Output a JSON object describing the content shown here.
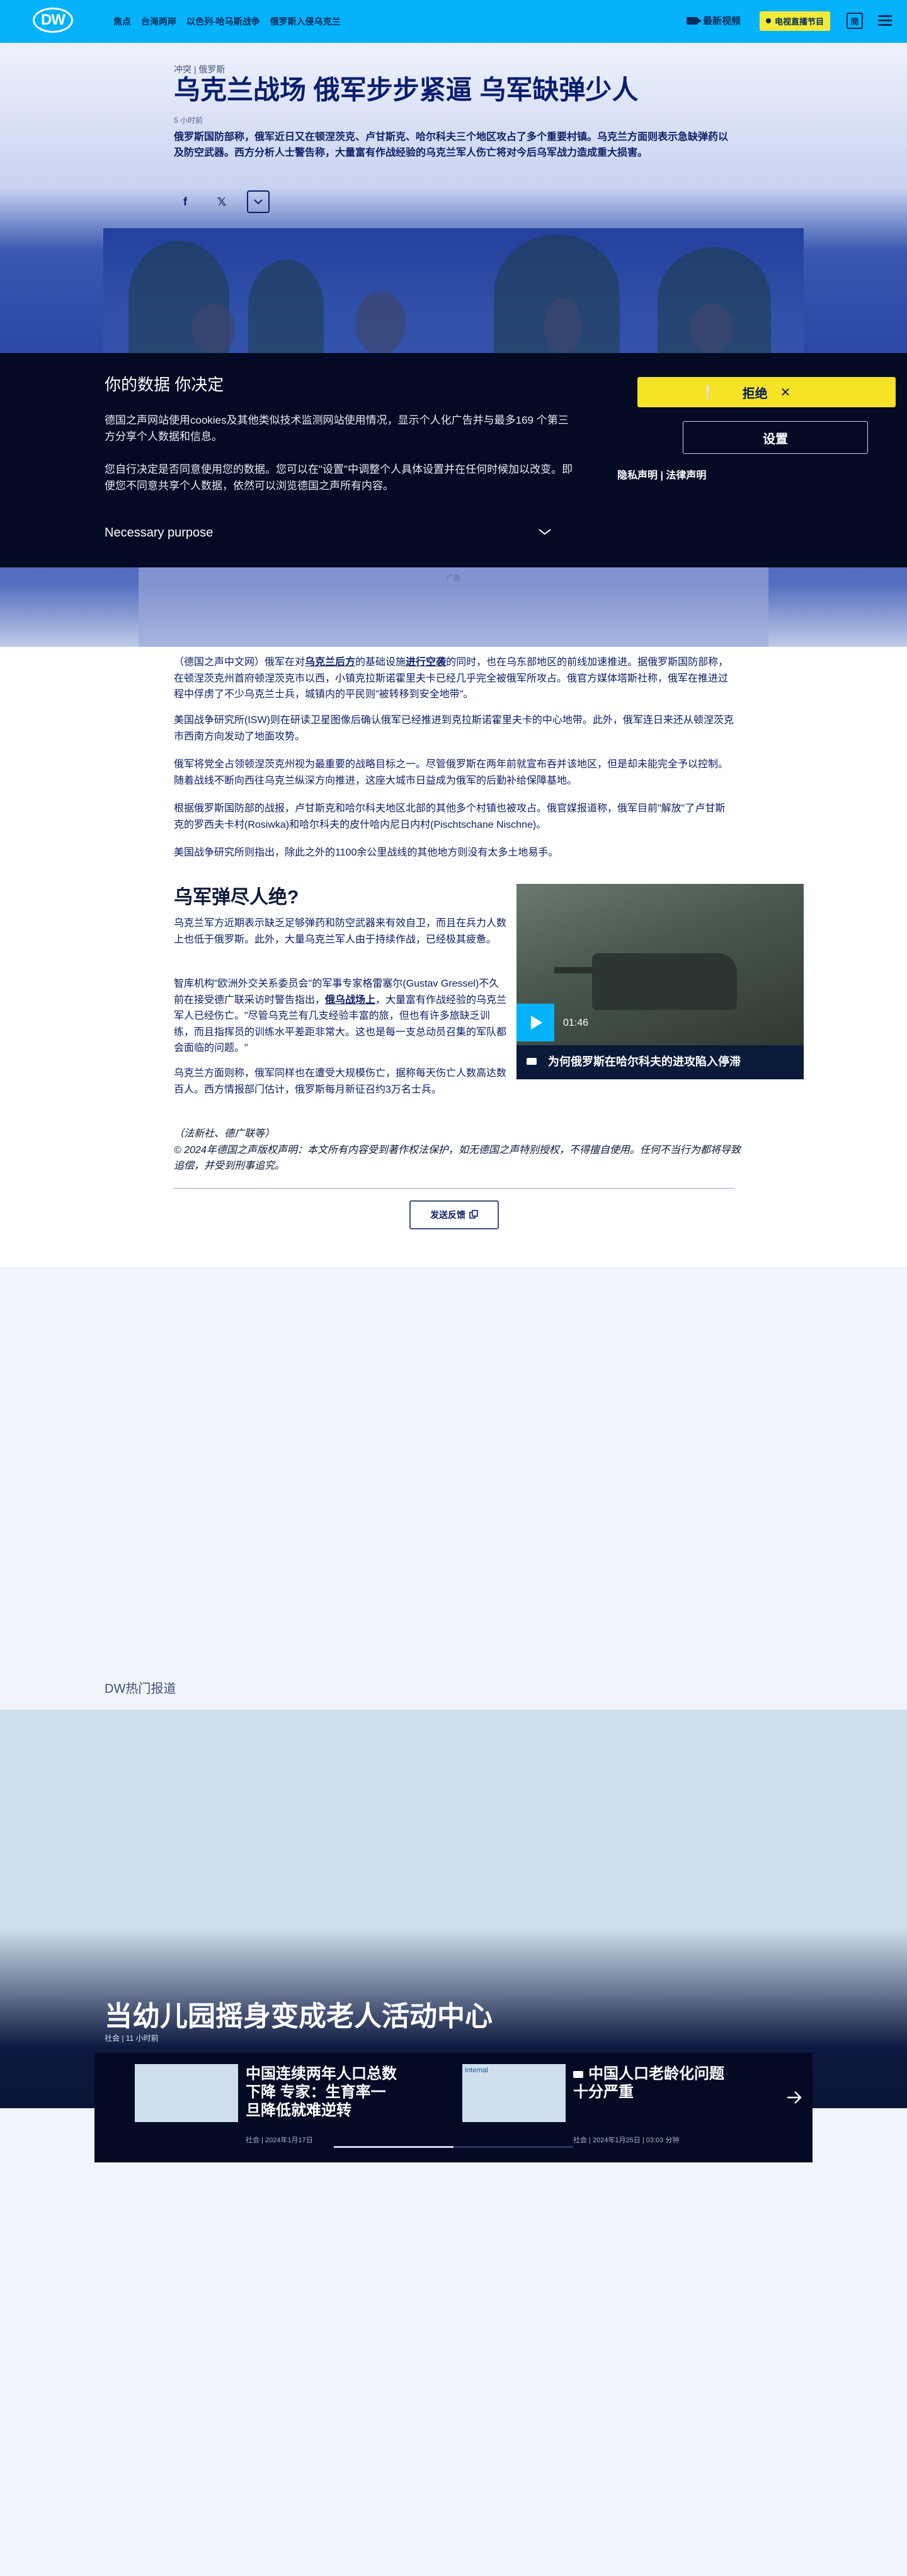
{
  "header": {
    "logo": "DW",
    "nav": [
      "焦点",
      "台海两岸",
      "以色列-哈马斯战争",
      "俄罗斯入侵乌克兰"
    ],
    "latest_video": "最新视频",
    "live": "电视直播节目",
    "lang": "简"
  },
  "article": {
    "breadcrumb": "冲突 | 俄罗斯",
    "title": "乌克兰战场 俄军步步紧逼 乌军缺弹少人",
    "time": "5 小时前",
    "teaser": "俄罗斯国防部称，俄军近日又在顿涅茨克、卢甘斯克、哈尔科夫三个地区攻占了多个重要村镇。乌克兰方面则表示急缺弹药以及防空武器。西方分析人士警告称，大量富有作战经验的乌克兰军人伤亡将对今后乌军战力造成重大损害。",
    "share_facebook": "f",
    "share_x": "𝕏",
    "ad_label": "广告",
    "p1_before": "（德国之声中文网）俄军在对",
    "p1_link1": "乌克兰后方",
    "p1_mid": "的基础设施",
    "p1_link2": "进行空袭",
    "p1_after": "的同时，也在乌东部地区的前线加速推进。据俄罗斯国防部称，在顿涅茨克州首府顿涅茨克市以西，小镇克拉斯诺霍里夫卡已经几乎完全被俄军所攻占。俄官方媒体塔斯社称，俄军在推进过程中俘虏了不少乌克兰士兵，城镇内的平民则\"被转移到安全地带\"。",
    "p2": "美国战争研究所(ISW)则在研读卫星图像后确认俄军已经推进到克拉斯诺霍里夫卡的中心地带。此外，俄军连日来还从顿涅茨克市西南方向发动了地面攻势。",
    "p3": "俄军将党全占领顿涅茨克州视为最重要的战略目标之一。尽管俄罗斯在两年前就宣布吞并该地区，但是却未能完全予以控制。随着战线不断向西往乌克兰纵深方向推进，这座大城市日益成为俄军的后勤补给保障基地。",
    "p4": "根据俄罗斯国防部的战报，卢甘斯克和哈尔科夫地区北部的其他多个村镇也被攻占。俄官媒报道称，俄军目前\"解放\"了卢甘斯克的罗西夫卡村(Rosiwka)和哈尔科夫的皮什哈内尼日内村(Pischtschane Nischne)。",
    "p5": "美国战争研究所则指出，除此之外的1100余公里战线的其他地方则没有太多土地易手。",
    "h2": "乌军弹尽人绝?",
    "c1": "乌克兰军方近期表示缺乏足够弹药和防空武器来有效自卫，而且在兵力人数上也低于俄罗斯。此外，大量乌克兰军人由于持续作战，已经极其疲惫。",
    "c2_before": "智库机构\"欧洲外交关系委员会\"的军事专家格雷塞尔(Gustav Gressel)不久前在接受德广联采访时警告指出，",
    "c2_link": "俄乌战场上",
    "c2_after": "，大量富有作战经验的乌克兰军人已经伤亡。\"尽管乌克兰有几支经验丰富的旅，但也有许多旅缺乏训练，而且指挥员的训练水平差距非常大。这也是每一支总动员召集的军队都会面临的问题。\"",
    "c3": "乌克兰方面则称，俄军同样也在遭受大规模伤亡，据称每天伤亡人数高达数百人。西方情报部门估计，俄罗斯每月新征召约3万名士兵。",
    "credit1": "（法新社、德广联等）",
    "credit2": "© 2024年德国之声版权声明：本文所有内容受到著作权法保护，如无德国之声特别授权，不得擅自使用。任何不当行为都将导致追偿，并受到刑事追究。",
    "feedback": "发送反馈"
  },
  "video": {
    "duration": "01:46",
    "title": "为何俄罗斯在哈尔科夫的进攻陷入停滞"
  },
  "consent": {
    "title": "你的数据 你决定",
    "p1": "德国之声网站使用cookies及其他类似技术监测网站使用情况，显示个人化广告并与最多169 个第三方分享个人数据和信息。",
    "p2": "您自行决定是否同意使用您的数据。您可以在\"设置\"中调整个人具体设置并在任何时候加以改变。即便您不同意共享个人数据，依然可以浏览德国之声所有内容。",
    "purpose": "Necessary purpose",
    "reject": "拒绝",
    "settings": "设置",
    "privacy": "隐私声明",
    "legal": "法律声明"
  },
  "trending": {
    "heading": "DW热门报道",
    "hero_title": "当幼儿园摇身变成老人活动中心",
    "hero_meta": "社会 | 11 小时前",
    "items": [
      {
        "title": "中国连续两年人口总数下降 专家：生育率一旦降低就难逆转",
        "meta": "社会 | 2024年1月17日"
      },
      {
        "title": "中国人口老龄化问题十分严重",
        "meta": "社会 | 2024年1月25日 | 03:03 分钟",
        "img_alt": "Internal"
      }
    ],
    "progress": 0.5
  }
}
